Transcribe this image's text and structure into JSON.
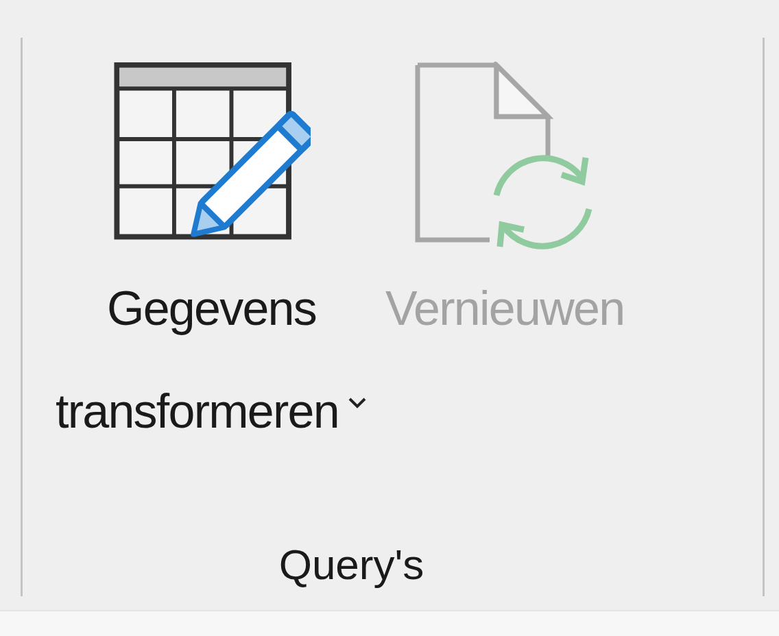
{
  "group": {
    "label": "Query's"
  },
  "buttons": [
    {
      "kind": "transform",
      "label_lines": [
        "Gegevens",
        "transformeren"
      ],
      "dropdown": true,
      "disabled": false
    },
    {
      "kind": "refresh",
      "label_lines": [
        "Vernieuwen"
      ],
      "dropdown": false,
      "disabled": true
    }
  ]
}
